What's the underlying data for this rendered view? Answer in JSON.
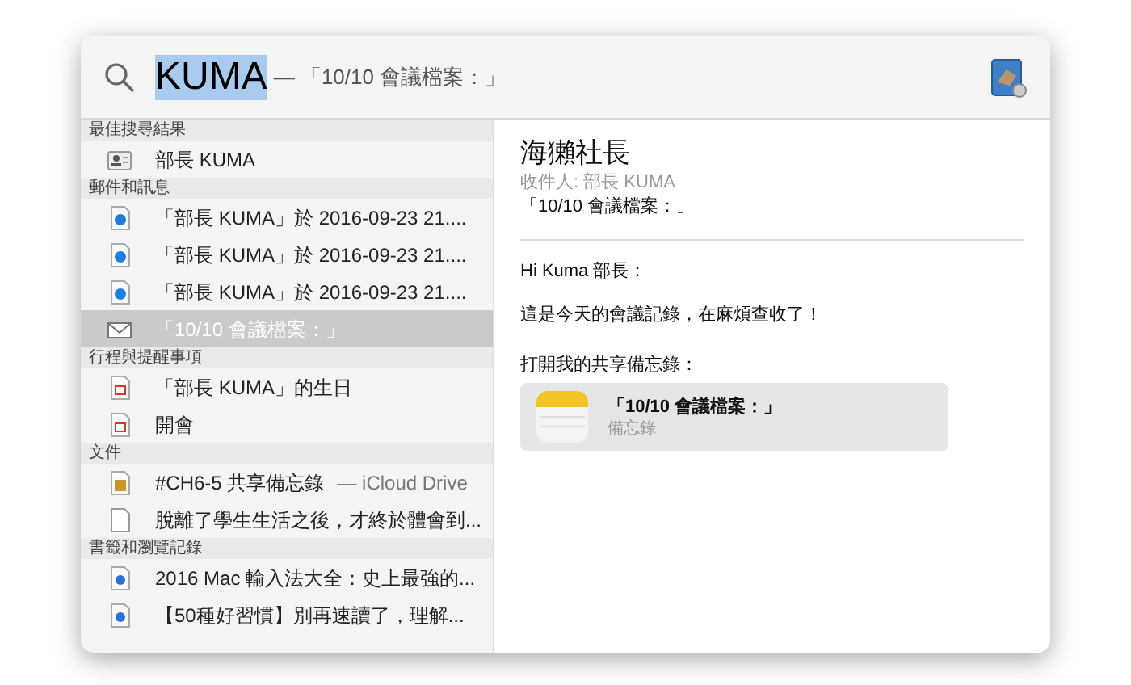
{
  "search": {
    "query": "KUMA",
    "suggestion": "— 「10/10 會議檔案：」"
  },
  "sections": [
    {
      "title": "最佳搜尋結果",
      "items": [
        {
          "kind": "contact",
          "label": "部長 KUMA",
          "selected": false
        }
      ]
    },
    {
      "title": "郵件和訊息",
      "items": [
        {
          "kind": "message",
          "label": "「部長 KUMA」於 2016-09-23 21....",
          "selected": false
        },
        {
          "kind": "message",
          "label": "「部長 KUMA」於 2016-09-23 21....",
          "selected": false
        },
        {
          "kind": "message",
          "label": "「部長 KUMA」於 2016-09-23 21....",
          "selected": false
        },
        {
          "kind": "mail",
          "label": "「10/10 會議檔案：」",
          "selected": true
        }
      ]
    },
    {
      "title": "行程與提醒事項",
      "items": [
        {
          "kind": "event",
          "label": "「部長 KUMA」的生日",
          "selected": false
        },
        {
          "kind": "event",
          "label": "開會",
          "selected": false
        }
      ]
    },
    {
      "title": "文件",
      "items": [
        {
          "kind": "note",
          "label": "#CH6-5 共享備忘錄",
          "detail": "— iCloud Drive",
          "selected": false
        },
        {
          "kind": "file",
          "label": "脫離了學生生活之後，才終於體會到...",
          "selected": false
        }
      ]
    },
    {
      "title": "書籤和瀏覽記錄",
      "items": [
        {
          "kind": "web",
          "label": "2016 Mac 輸入法大全：史上最強的...",
          "selected": false
        },
        {
          "kind": "web",
          "label": "【50種好習慣】別再速讀了，理解...",
          "selected": false
        }
      ]
    }
  ],
  "preview": {
    "sender": "海獺社長",
    "recipient": "收件人: 部長 KUMA",
    "subject": "「10/10 會議檔案：」",
    "body": [
      "Hi Kuma 部長：",
      "這是今天的會議記錄，在麻煩查收了！"
    ],
    "share_label": "打開我的共享備忘錄：",
    "attachment": {
      "title": "「10/10 會議檔案：」",
      "subtitle": "備忘錄"
    }
  }
}
